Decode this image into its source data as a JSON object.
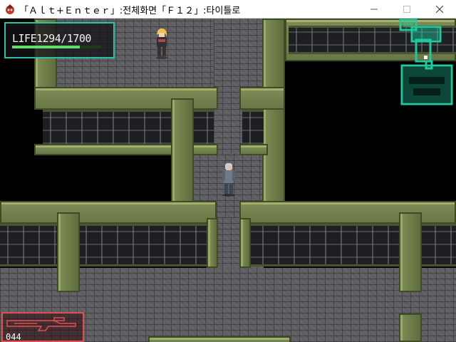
{
  "window": {
    "title": "「Ａｌｔ+Ｅｎｔｅｒ」:전체화면「Ｆ１２」:타이틀로"
  },
  "hud": {
    "life_label": "LIFE1294/1700",
    "life_current": 1294,
    "life_max": 1700,
    "ammo_text": "044"
  },
  "icons": {
    "app": "rpg-app-icon",
    "minimize": "minimize-icon",
    "maximize": "maximize-icon",
    "close": "close-icon"
  },
  "colors": {
    "hud_border": "#2fbfa4",
    "minimap": "#1fc9a0",
    "weapon_border": "#e05050",
    "wall_green": "#7b8a55"
  }
}
